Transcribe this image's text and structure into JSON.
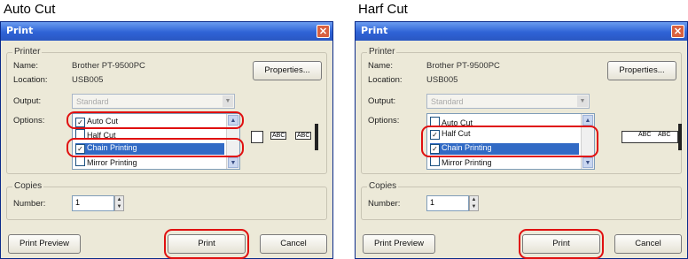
{
  "panels": [
    {
      "heading": "Auto Cut",
      "dialog_title": "Print",
      "printer_group": "Printer",
      "name_label": "Name:",
      "name_value": "Brother PT-9500PC",
      "location_label": "Location:",
      "location_value": "USB005",
      "properties_button": "Properties...",
      "output_label": "Output:",
      "output_value": "Standard",
      "options_label": "Options:",
      "options": [
        {
          "label": "Auto Cut",
          "checked": true,
          "selected": false
        },
        {
          "label": "Half Cut",
          "checked": false,
          "selected": false
        },
        {
          "label": "Chain Printing",
          "checked": true,
          "selected": true
        },
        {
          "label": "Mirror Printing",
          "checked": false,
          "selected": false
        }
      ],
      "copies_group": "Copies",
      "number_label": "Number:",
      "number_value": "1",
      "preview_button": "Print Preview",
      "print_button": "Print",
      "cancel_button": "Cancel",
      "tape_label_a": "ABC",
      "tape_label_b": "ABC"
    },
    {
      "heading": "Harf Cut",
      "dialog_title": "Print",
      "printer_group": "Printer",
      "name_label": "Name:",
      "name_value": "Brother PT-9500PC",
      "location_label": "Location:",
      "location_value": "USB005",
      "properties_button": "Properties...",
      "output_label": "Output:",
      "output_value": "Standard",
      "options_label": "Options:",
      "options": [
        {
          "label": "Auto Cut",
          "checked": false,
          "selected": false
        },
        {
          "label": "Half Cut",
          "checked": true,
          "selected": false
        },
        {
          "label": "Chain Printing",
          "checked": true,
          "selected": true
        },
        {
          "label": "Mirror Printing",
          "checked": false,
          "selected": false
        }
      ],
      "copies_group": "Copies",
      "number_label": "Number:",
      "number_value": "1",
      "preview_button": "Print Preview",
      "print_button": "Print",
      "cancel_button": "Cancel",
      "tape_label_a": "ABC",
      "tape_label_b": "ABC"
    }
  ],
  "colors": {
    "highlight": "#e01010",
    "titlebar": "#2f63d6",
    "selection": "#316ac5"
  }
}
